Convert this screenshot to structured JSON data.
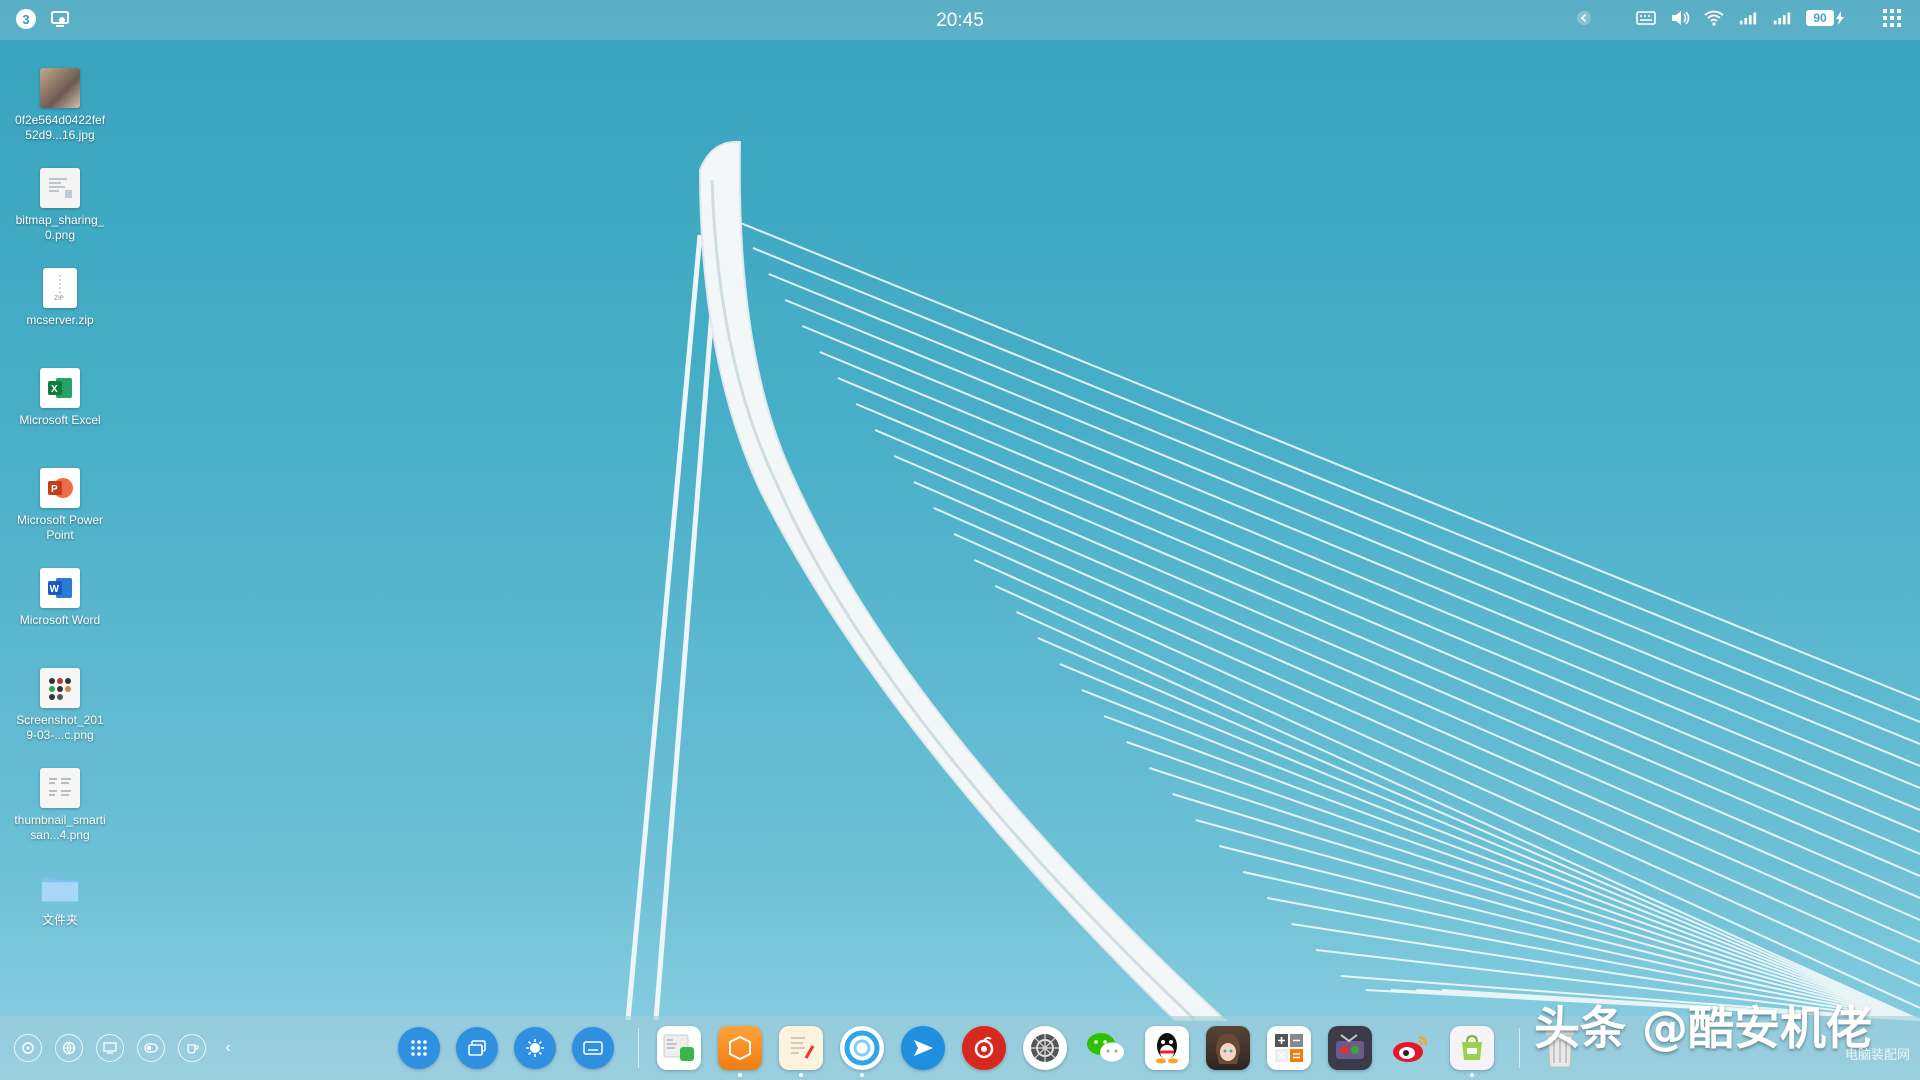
{
  "topbar": {
    "notification_count": "3",
    "clock": "20:45",
    "battery": "90"
  },
  "desktop": {
    "icons": [
      {
        "label": "0f2e564d0422fef52d9...16.jpg",
        "icon": "photo-thumbnail-icon"
      },
      {
        "label": "bitmap_sharing_0.png",
        "icon": "image-file-icon"
      },
      {
        "label": "mcserver.zip",
        "icon": "zip-file-icon"
      },
      {
        "label": "Microsoft Excel",
        "icon": "excel-icon"
      },
      {
        "label": "Microsoft PowerPoint",
        "icon": "powerpoint-icon"
      },
      {
        "label": "Microsoft Word",
        "icon": "word-icon"
      },
      {
        "label": "Screenshot_2019-03-...c.png",
        "icon": "screenshot-thumbnail-icon"
      },
      {
        "label": "thumbnail_smartisan...4.png",
        "icon": "thumbnail-icon"
      },
      {
        "label": "文件夹",
        "icon": "folder-icon"
      }
    ]
  },
  "dock": {
    "apps": [
      "file-manager-icon",
      "sheets-icon",
      "notes-icon",
      "browser-icon",
      "send-icon",
      "netease-music-icon",
      "settings-icon",
      "wechat-icon",
      "qq-icon",
      "avatar-app-icon",
      "calculator-icon",
      "video-icon",
      "weibo-icon",
      "app-store-icon",
      "trash-icon"
    ]
  },
  "watermark": {
    "text": "头条 @酷安机佬",
    "site": "电脑装配网"
  }
}
